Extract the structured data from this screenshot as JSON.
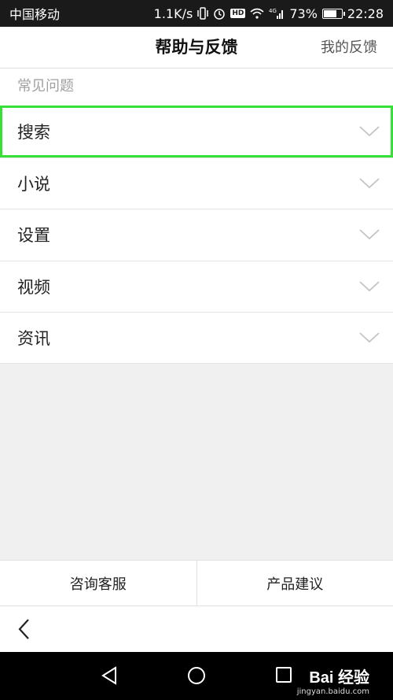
{
  "status_bar": {
    "carrier": "中国移动",
    "speed": "1.1K/s",
    "battery": "73%",
    "time": "22:28"
  },
  "header": {
    "title": "帮助与反馈",
    "action": "我的反馈"
  },
  "section": {
    "label": "常见问题"
  },
  "faq": {
    "items": [
      {
        "label": "搜索"
      },
      {
        "label": "小说"
      },
      {
        "label": "设置"
      },
      {
        "label": "视频"
      },
      {
        "label": "资讯"
      }
    ]
  },
  "bottom": {
    "consult": "咨询客服",
    "suggest": "产品建议"
  },
  "watermark": {
    "logo": "Bai 经验",
    "url": "jingyan.baidu.com"
  },
  "colors": {
    "highlight": "#36e036",
    "status_bg": "#1a1a1a"
  }
}
